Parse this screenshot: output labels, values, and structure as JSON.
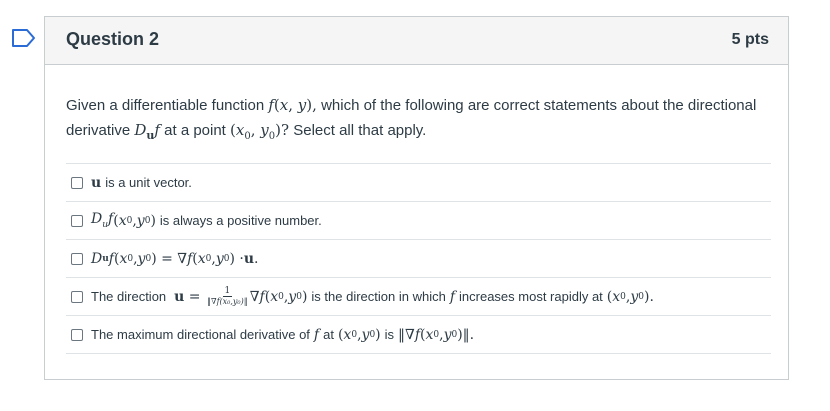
{
  "question": {
    "title": "Question 2",
    "points": "5 pts",
    "text_prefix": "Given a differentiable function",
    "text_func": "f(x, y),",
    "text_mid": "which of the following are correct statements about the directional derivative",
    "text_deriv": "D",
    "text_deriv_sub": "u",
    "text_deriv_f": "f",
    "text_at": "at a point",
    "text_point": "(x0, y0)?",
    "text_suffix": "Select all that apply."
  },
  "answers": [
    {
      "math": "u",
      "text": "is a unit vector."
    },
    {
      "math": "Du f(x0, y0)",
      "text": "is always a positive number."
    },
    {
      "math": "Du f(x0, y0) = ∇f(x0, y0) · u.",
      "text": ""
    },
    {
      "prefix": "The direction",
      "math": "u = (1/‖∇f(x0,y0)‖) ∇f(x0, y0)",
      "text": "is the direction in which",
      "text2": "increases most rapidly at",
      "point": "(x0, y0)."
    },
    {
      "prefix": "The maximum directional derivative of",
      "text": "at",
      "point": "(x0, y0)",
      "text2": "is",
      "math": "‖∇f(x0, y0)‖."
    }
  ],
  "icons": {
    "flag": "flag-outline-icon"
  },
  "colors": {
    "accent": "#2b6bd6",
    "text": "#2d3b45",
    "border": "#c7cdd1",
    "header_bg": "#f5f5f5"
  }
}
